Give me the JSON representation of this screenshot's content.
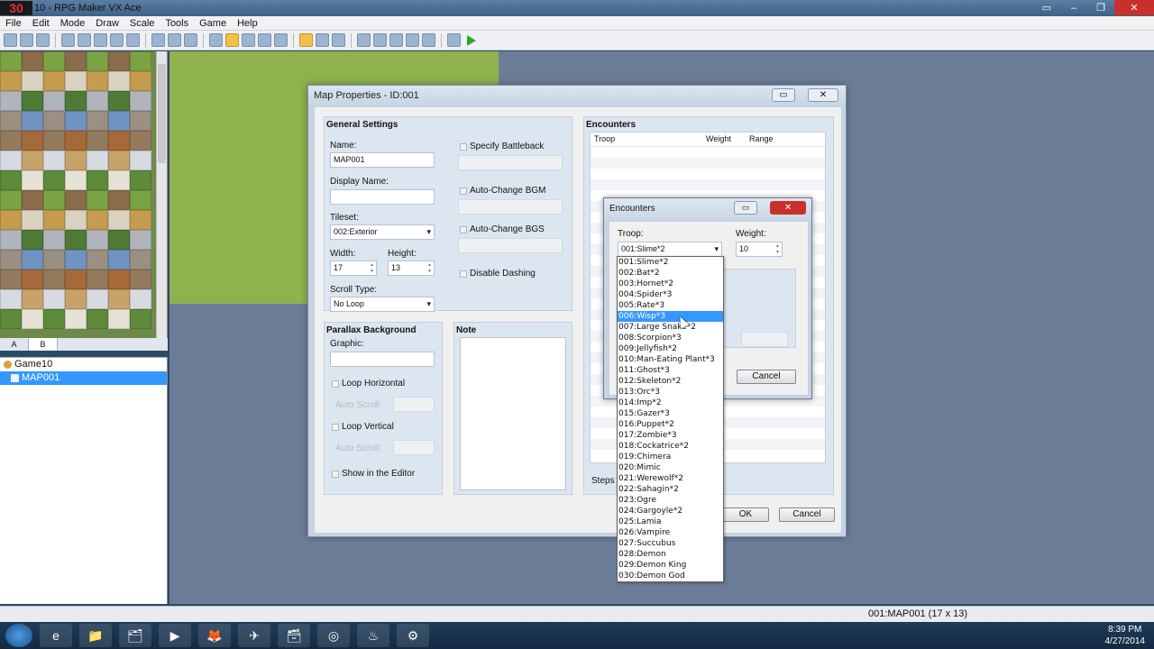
{
  "window": {
    "app_icon_text": "30",
    "title": "10 - RPG Maker VX Ace",
    "buttons": [
      "▭",
      "–",
      "❐",
      "✕"
    ]
  },
  "menu": [
    "File",
    "Edit",
    "Mode",
    "Draw",
    "Scale",
    "Tools",
    "Game",
    "Help"
  ],
  "palette_tabs": [
    "A",
    "B"
  ],
  "map_tree": {
    "root": "Game10",
    "selected": "MAP001"
  },
  "status": {
    "coords": "001:MAP001 (17 x 13)"
  },
  "taskbar": {
    "apps": [
      "e",
      "📁",
      "🗂",
      "▶",
      "🦊",
      "✈",
      "🗃",
      "◎",
      "♨",
      "⚙"
    ],
    "time": "8:39 PM",
    "date": "4/27/2014"
  },
  "map_properties": {
    "title": "Map Properties - ID:001",
    "general_settings": {
      "heading": "General Settings",
      "name_label": "Name:",
      "name_value": "MAP001",
      "display_name_label": "Display Name:",
      "display_name_value": "",
      "tileset_label": "Tileset:",
      "tileset_value": "002:Exterior",
      "width_label": "Width:",
      "width_value": "17",
      "height_label": "Height:",
      "height_value": "13",
      "scroll_type_label": "Scroll Type:",
      "scroll_type_value": "No Loop",
      "specify_battleback": "Specify Battleback",
      "auto_change_bgm": "Auto-Change BGM",
      "auto_change_bgs": "Auto-Change BGS",
      "disable_dashing": "Disable Dashing"
    },
    "parallax": {
      "heading": "Parallax Background",
      "graphic_label": "Graphic:",
      "graphic_value": "",
      "loop_horizontal": "Loop Horizontal",
      "auto_scroll_h": "Auto Scroll:",
      "loop_vertical": "Loop Vertical",
      "auto_scroll_v": "Auto Scroll:",
      "show_in_editor": "Show in the Editor"
    },
    "note": {
      "heading": "Note"
    },
    "encounters": {
      "heading": "Encounters",
      "col_troop": "Troop",
      "col_weight": "Weight",
      "col_range": "Range",
      "steps_label": "Steps"
    },
    "ok": "OK",
    "cancel": "Cancel"
  },
  "encounter_dialog": {
    "title": "Encounters",
    "troop_label": "Troop:",
    "troop_value": "001:Slime*2",
    "weight_label": "Weight:",
    "weight_value": "10",
    "cancel": "Cancel"
  },
  "troop_list": [
    "001:Slime*2",
    "002:Bat*2",
    "003:Hornet*2",
    "004:Spider*3",
    "005:Rate*3",
    "006:Wisp*3",
    "007:Large Snake*2",
    "008:Scorpion*3",
    "009:Jellyfish*2",
    "010:Man-Eating Plant*3",
    "011:Ghost*3",
    "012:Skeleton*2",
    "013:Orc*3",
    "014:Imp*2",
    "015:Gazer*3",
    "016:Puppet*2",
    "017:Zombie*3",
    "018:Cockatrice*2",
    "019:Chimera",
    "020:Mimic",
    "021:Werewolf*2",
    "022:Sahagin*2",
    "023:Ogre",
    "024:Gargoyle*2",
    "025:Lamia",
    "026:Vampire",
    "027:Succubus",
    "028:Demon",
    "029:Demon King",
    "030:Demon God"
  ],
  "troop_list_selected_index": 5,
  "colors": {
    "selection": "#3399ff",
    "grass": "#8fb24f",
    "map_bg": "#6c7e97",
    "dialog_frame": "#c5d3e3"
  }
}
